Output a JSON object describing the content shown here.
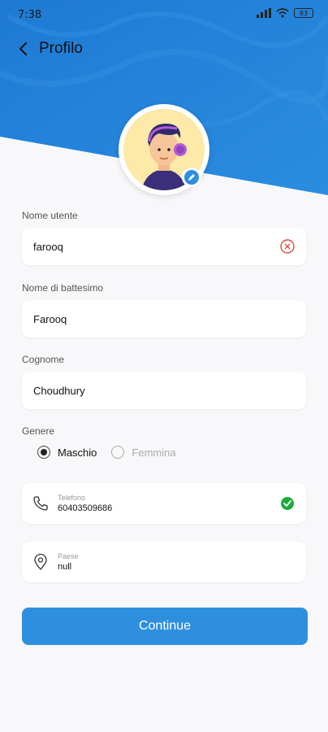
{
  "status": {
    "time": "7:38",
    "battery": "83"
  },
  "header": {
    "title": "Profilo"
  },
  "colors": {
    "accent": "#2e8fde",
    "header_bg": "#1f7fd6",
    "success": "#1cab3c",
    "error": "#e04b3a"
  },
  "form": {
    "username": {
      "label": "Nome utente",
      "value": "farooq"
    },
    "first_name": {
      "label": "Nome di battesimo",
      "value": "Farooq"
    },
    "last_name": {
      "label": "Cognome",
      "value": "Choudhury"
    },
    "gender": {
      "label": "Genere",
      "options": [
        "Maschio",
        "Femmina"
      ],
      "selected": "Maschio"
    },
    "phone": {
      "label": "Telefono",
      "value": "60403509686"
    },
    "country": {
      "label": "Paese",
      "value": "null"
    }
  },
  "actions": {
    "continue_label": "Continue"
  }
}
